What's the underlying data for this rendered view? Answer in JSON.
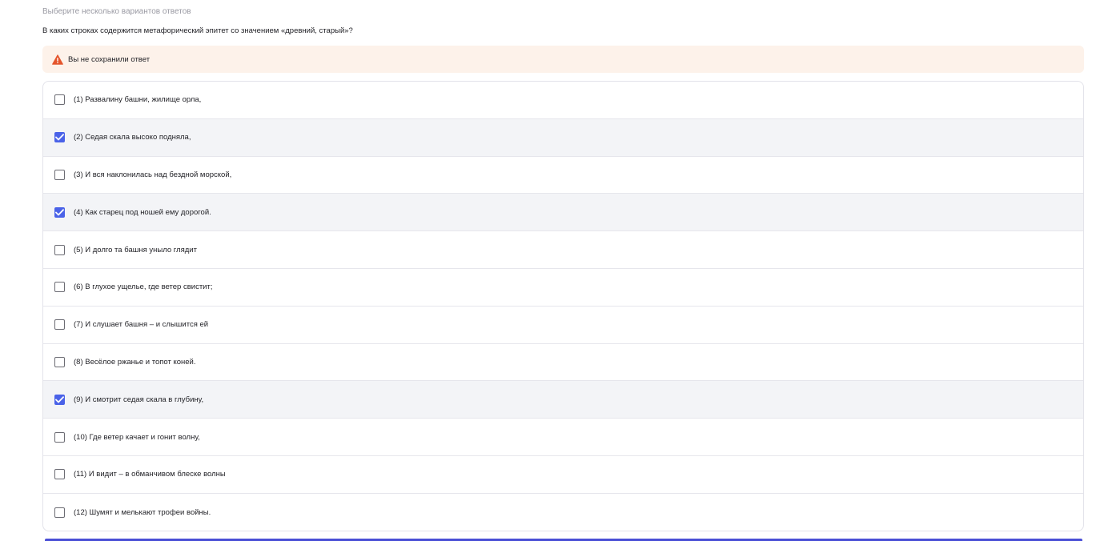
{
  "hint": "Выберите несколько вариантов ответов",
  "question": "В каких строках содержится метафорический эпитет со значением «древний, старый»?",
  "warning": {
    "icon": "warning-triangle-icon",
    "text": "Вы не сохранили ответ",
    "color": "#e4552c"
  },
  "accent_color": "#4a62e8",
  "options": [
    {
      "label": "(1) Развалину башни, жилище орла,",
      "checked": false
    },
    {
      "label": "(2) Седая скала высоко подняла,",
      "checked": true
    },
    {
      "label": "(3) И вся наклонилась над бездной морской,",
      "checked": false
    },
    {
      "label": "(4) Как старец под ношей ему дорогой.",
      "checked": true
    },
    {
      "label": "(5) И долго та башня уныло глядит",
      "checked": false
    },
    {
      "label": "(6) В глухое ущелье, где ветер свистит;",
      "checked": false
    },
    {
      "label": "(7) И слушает башня – и слышится ей",
      "checked": false
    },
    {
      "label": "(8) Весёлое ржанье и топот коней.",
      "checked": false
    },
    {
      "label": "(9) И смотрит седая скала в глубину,",
      "checked": true
    },
    {
      "label": "(10) Где ветер качает и гонит волну,",
      "checked": false
    },
    {
      "label": "(11) И видит – в обманчивом блеске волны",
      "checked": false
    },
    {
      "label": "(12) Шумят и мелькают трофеи войны.",
      "checked": false
    }
  ]
}
